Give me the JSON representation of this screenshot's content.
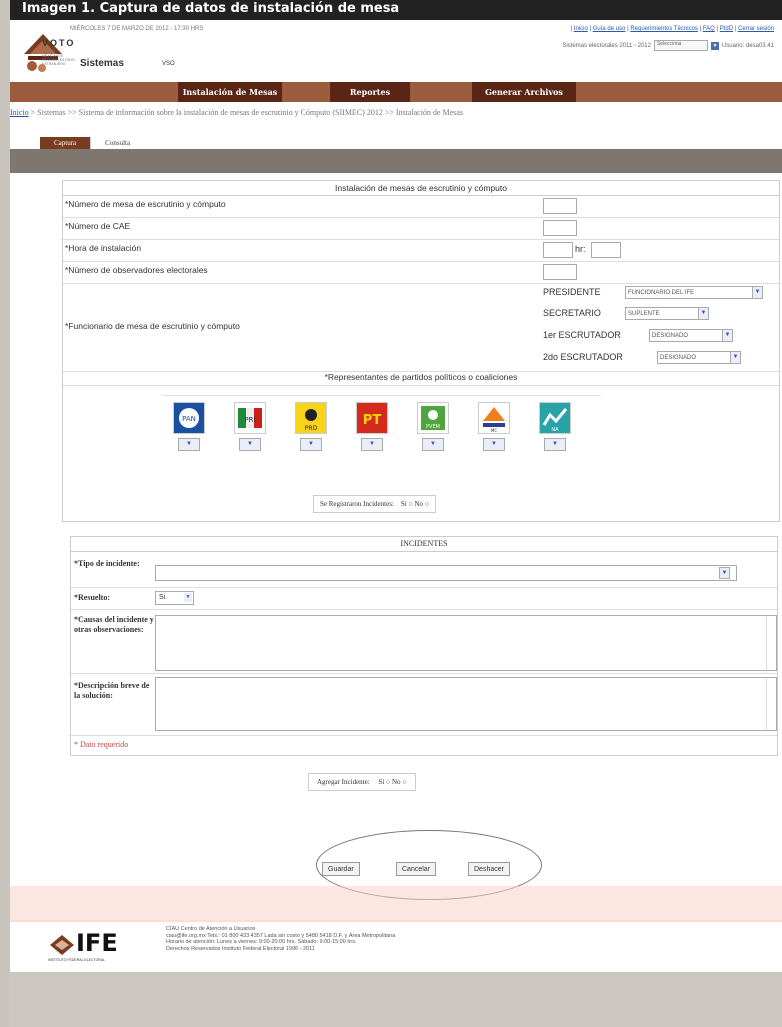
{
  "top_title": "Imagen 1. Captura de datos de instalación de mesa",
  "header": {
    "datetime": "MIÉRCOLES 7 DE MARZO DE 2012 - 17:30 HRS",
    "links": [
      "Inicio",
      "Guía de uso",
      "Requerimientos Técnicos",
      "FAQ",
      "PIdD",
      "Cerrar sesión"
    ],
    "sistemas_label": "Sistemas electorales 2011 - 2012",
    "select_value": "Selecciona",
    "user_label": "Usuario: desa03.41",
    "voto_logo_text": "VOTO",
    "voto_logo_sub": "DE LOS MEXICANOS RESIDENTES EN EL EXTRANJERO",
    "sistemas": "Sistemas",
    "vso": "VSO"
  },
  "menu": [
    "Instalación de Mesas",
    "Reportes",
    "Generar Archivos"
  ],
  "breadcrumb": {
    "home": "Inicio",
    "path": " > Sistemas >> Sistema de información sobre la instalación de mesas de escrutinio y Cómputo (SIIMEC) 2012 >> Instalación de Mesas"
  },
  "tabs": [
    "Captura",
    "Consulta"
  ],
  "form": {
    "caption": "Instalación de mesas de escrutinio y cómputo",
    "fields": {
      "mesa": "*Número de mesa de escrutinio y cómputo",
      "cae": "*Número de CAE",
      "hora": "*Hora de instalación",
      "hr_label": "hr:",
      "observadores": "*Número de observadores electorales",
      "funcionario": "*Funcionario de mesa de escrutinio y cómputo"
    },
    "roles": [
      {
        "label": "PRESIDENTE",
        "value": "FUNCIONARIO DEL IFE"
      },
      {
        "label": "SECRETARIO",
        "value": "SUPLENTE"
      },
      {
        "label": "1er ESCRUTADOR",
        "value": "DESIGNADO"
      },
      {
        "label": "2do ESCRUTADOR",
        "value": "DESIGNADO"
      }
    ],
    "representantes": "*Representantes de partidos políticos o coaliciones",
    "incidentes_q": "Se Registraron Incidentes:",
    "si": "Si",
    "no": "No",
    "party_logos": [
      {
        "text": "PAN",
        "bg": "#1b4fa0",
        "fg": "#fff"
      },
      {
        "text": "PRI",
        "bg": "#ffffff",
        "fg": "#c9221c"
      },
      {
        "text": "PRD",
        "bg": "#f7d31a",
        "fg": "#222"
      },
      {
        "text": "PT",
        "bg": "#d52b1e",
        "fg": "#ffd800"
      },
      {
        "text": "PVEM",
        "bg": "#4fa53e",
        "fg": "#fff"
      },
      {
        "text": "MC",
        "bg": "#ffffff",
        "fg": "#f0801a"
      },
      {
        "text": "NA",
        "bg": "#2aa3a8",
        "fg": "#fff"
      }
    ]
  },
  "incidentes": {
    "caption": "INCIDENTES",
    "tipo_label": "*Tipo de incidente:",
    "resuelto_label": "*Resuelto:",
    "resuelto_value": "Si",
    "causas_label": "*Causas del incidente y otras observaciones:",
    "descripcion_label": "*Descripción breve de la solución:",
    "requerido": "* Dato requerido"
  },
  "agregar": {
    "label": "Agregar Incidente:",
    "si": "Si",
    "no": "No"
  },
  "buttons": [
    "Guardar",
    "Cancelar",
    "Deshacer"
  ],
  "footer": {
    "brand": "IFE",
    "brand_sub": "INSTITUTO FEDERAL ELECTORAL",
    "lines": [
      "CIAU Centro de Atención a Usuarios",
      "ciau@ife.org.mx Tels.: 01 800 433 4357 Lada sin costo y 5480 5418 D.F. y Área Metropolitana",
      "Horario de atención: Lunes a viernes: 9:00-20:00 hrs. Sábado: 9:00-15:00 hrs.",
      "Derechos Reservados Instituto Federal Electoral 1996 - 2011"
    ]
  }
}
